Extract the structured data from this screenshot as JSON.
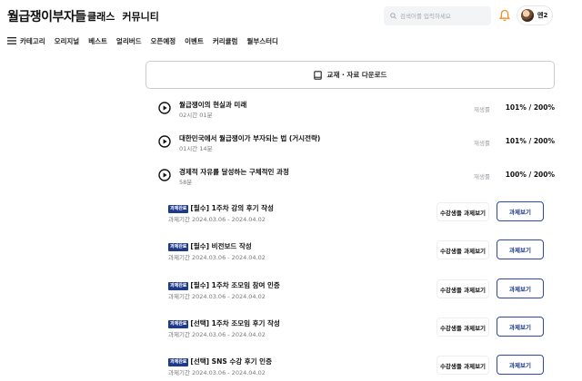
{
  "header": {
    "logo": "월급쟁이부자들",
    "nav": [
      "클래스",
      "커뮤니티"
    ],
    "search_placeholder": "검색어를 입력하세요",
    "profile_name": "엔2"
  },
  "subnav": {
    "category_label": "카테고리",
    "items": [
      "오리지널",
      "베스트",
      "얼리버드",
      "오픈예정",
      "이벤트",
      "커리큘럼",
      "월부스터디"
    ]
  },
  "download_label": "교재 · 자료 다운로드",
  "lectures": [
    {
      "title": "월급쟁이의 현실과 미래",
      "duration": "02시간 01분",
      "status": "재생률",
      "progress": "101% / 200%"
    },
    {
      "title": "대한민국에서 월급쟁이가 부자되는 법 (거시전략)",
      "duration": "01시간 14분",
      "status": "재생률",
      "progress": "101% / 200%"
    },
    {
      "title": "경제적 자유를 달성하는 구체적인 과정",
      "duration": "58분",
      "status": "재생률",
      "progress": "100% / 200%"
    }
  ],
  "assignments": [
    {
      "badge": "과제완료",
      "title": "[필수] 1주차 강의 후기 작성",
      "period": "과제기간 2024.03.06 - 2024.04.02",
      "others_label": "수강생들 과제보기",
      "view_label": "과제보기"
    },
    {
      "badge": "과제완료",
      "title": "[필수] 비전보드 작성",
      "period": "과제기간 2024.03.06 - 2024.04.02",
      "others_label": "수강생들 과제보기",
      "view_label": "과제보기"
    },
    {
      "badge": "과제완료",
      "title": "[필수] 1주차 조모임 참여 인증",
      "period": "과제기간 2024.03.06 - 2024.04.02",
      "others_label": "수강생들 과제보기",
      "view_label": "과제보기"
    },
    {
      "badge": "과제완료",
      "title": "[선택] 1주차 조모임 후기 작성",
      "period": "과제기간 2024.03.06 - 2024.04.02",
      "others_label": "수강생들 과제보기",
      "view_label": "과제보기"
    },
    {
      "badge": "과제완료",
      "title": "[선택] SNS 수강 후기 인증",
      "period": "과제기간 2024.03.06 - 2024.04.02",
      "others_label": "수강생들 과제보기",
      "view_label": "과제보기"
    }
  ],
  "colors": {
    "accent": "#1f3a8a",
    "bell": "#f28c28"
  },
  "icons": [
    "search-icon",
    "bell-icon",
    "menu-icon",
    "book-icon",
    "play-icon"
  ]
}
